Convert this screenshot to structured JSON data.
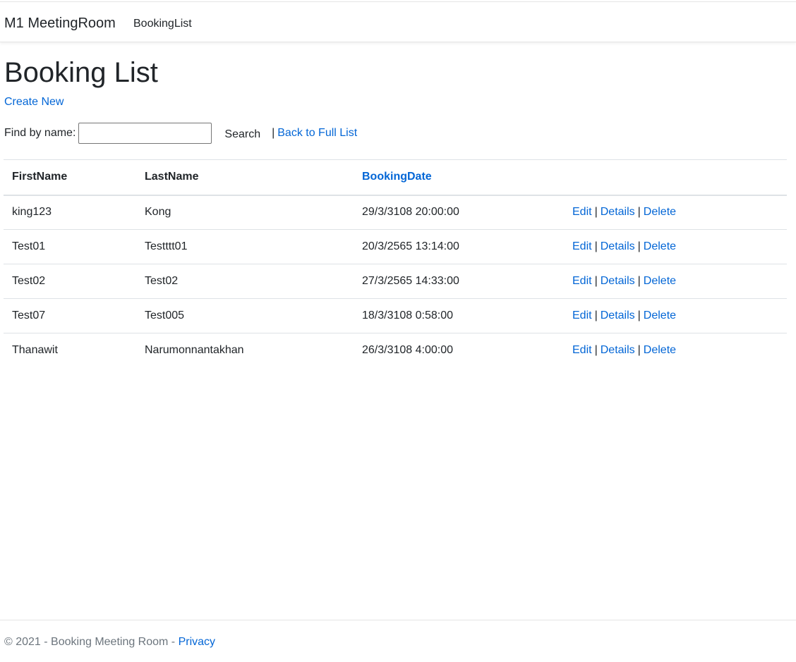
{
  "nav": {
    "brand": "M1 MeetingRoom",
    "links": [
      "BookingList"
    ]
  },
  "main": {
    "title": "Booking List",
    "create_new": "Create New",
    "search": {
      "label": "Find by name:",
      "value": "",
      "button": "Search",
      "separator": "|",
      "back_link": "Back to Full List"
    }
  },
  "table": {
    "headers": [
      "FirstName",
      "LastName",
      "BookingDate",
      ""
    ],
    "rows": [
      {
        "first": "king123",
        "last": "Kong",
        "date": "29/3/3108 20:00:00"
      },
      {
        "first": "Test01",
        "last": "Testttt01",
        "date": "20/3/2565 13:14:00"
      },
      {
        "first": "Test02",
        "last": "Test02",
        "date": "27/3/2565 14:33:00"
      },
      {
        "first": "Test07",
        "last": "Test005",
        "date": "18/3/3108 0:58:00"
      },
      {
        "first": "Thanawit",
        "last": "Narumonnantakhan",
        "date": "26/3/3108 4:00:00"
      }
    ],
    "actions": {
      "edit": "Edit",
      "details": "Details",
      "delete": "Delete",
      "pipe": "|"
    }
  },
  "footer": {
    "text": "© 2021 - Booking Meeting Room -",
    "privacy": "Privacy"
  },
  "colors": {
    "link": "#0366d6",
    "text": "#212529",
    "muted": "#6c757d",
    "border": "#dee2e6"
  }
}
